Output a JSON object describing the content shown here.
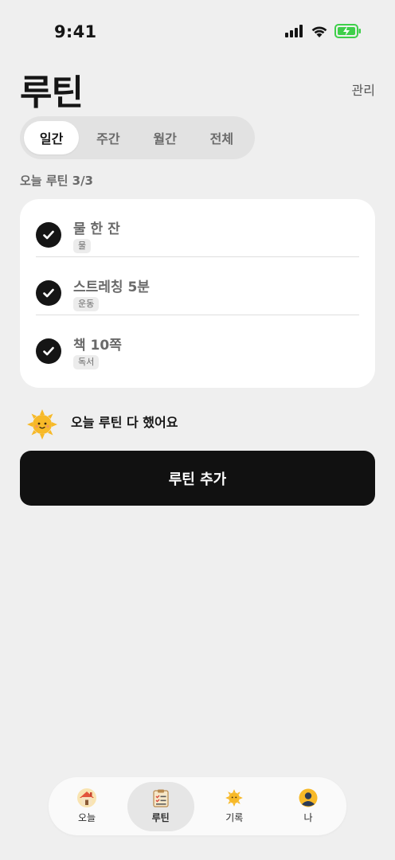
{
  "status": {
    "time": "9:41"
  },
  "header": {
    "title": "루틴",
    "manage_label": "관리"
  },
  "segments": [
    {
      "label": "일간",
      "active": true
    },
    {
      "label": "주간",
      "active": false
    },
    {
      "label": "월간",
      "active": false
    },
    {
      "label": "전체",
      "active": false
    }
  ],
  "progress_label": "오늘 루틴 3/3",
  "routines": [
    {
      "name": "물 한 잔",
      "tag": "물",
      "done": true
    },
    {
      "name": "스트레칭 5분",
      "tag": "운동",
      "done": true
    },
    {
      "name": "책 10쪽",
      "tag": "독서",
      "done": true
    }
  ],
  "done_banner": {
    "icon": "sun-icon",
    "text": "오늘 루틴 다 했어요"
  },
  "add_button_label": "루틴 추가",
  "tabs": [
    {
      "label": "오늘",
      "icon": "house-icon",
      "active": false
    },
    {
      "label": "루틴",
      "icon": "checklist-icon",
      "active": true
    },
    {
      "label": "기록",
      "icon": "sun-icon",
      "active": false
    },
    {
      "label": "나",
      "icon": "avatar-icon",
      "active": false
    }
  ],
  "colors": {
    "background": "#efefef",
    "accent": "#111111",
    "battery": "#3ecf4a",
    "sun": "#f7b928"
  }
}
